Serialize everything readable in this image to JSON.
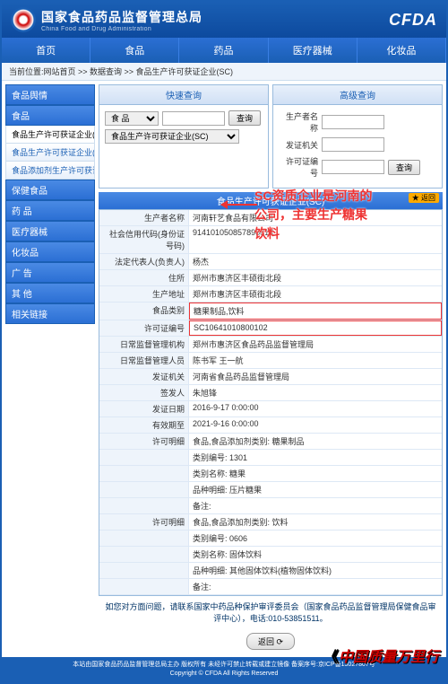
{
  "header": {
    "title_cn": "国家食品药品监督管理总局",
    "title_en": "China Food and Drug Administration",
    "brand": "CFDA"
  },
  "nav": [
    "首页",
    "食品",
    "药品",
    "医疗器械",
    "化妆品"
  ],
  "breadcrumb": "当前位置:网站首页 >> 数据查询 >> 食品生产许可获证企业(SC)",
  "sidebar": {
    "groups": [
      {
        "h": "食品舆情",
        "items": []
      },
      {
        "h": "食品",
        "items": [
          "食品生产许可获证企业(SC)",
          "食品生产许可获证企业(QS)",
          "食品添加剂生产许可获证企业"
        ]
      },
      {
        "h": "保健食品",
        "items": []
      },
      {
        "h": "药 品",
        "items": []
      },
      {
        "h": "医疗器械",
        "items": []
      },
      {
        "h": "化妆品",
        "items": []
      },
      {
        "h": "广 告",
        "items": []
      },
      {
        "h": "其 他",
        "items": []
      },
      {
        "h": "相关链接",
        "items": []
      }
    ]
  },
  "left_panel": {
    "title": "快速查询",
    "cat_label": "食 品",
    "btn": "查询",
    "sel": "食品生产许可获证企业(SC)"
  },
  "right_panel": {
    "title": "高级查询",
    "r1": "生产者名称",
    "r2": "发证机关",
    "r3": "许可证编号",
    "btn": "查询"
  },
  "section": {
    "title": "食品生产许可获证企业(SC)",
    "back": "★ 返回"
  },
  "detail": [
    {
      "l": "生产者名称",
      "v": "河南轩艺食品有限公司"
    },
    {
      "l": "社会信用代码(身份证号码)",
      "v": "91410105085789881K"
    },
    {
      "l": "法定代表人(负责人)",
      "v": "杨杰"
    },
    {
      "l": "住所",
      "v": "郑州市惠济区丰硕街北段"
    },
    {
      "l": "生产地址",
      "v": "郑州市惠济区丰硕街北段"
    },
    {
      "l": "食品类别",
      "v": "糖果制品,饮料",
      "hl": true
    },
    {
      "l": "许可证编号",
      "v": "SC10641010800102",
      "hl": true
    },
    {
      "l": "日常监督管理机构",
      "v": "郑州市惠济区食品药品监督管理局"
    },
    {
      "l": "日常监督管理人员",
      "v": "陈书军 王一航"
    },
    {
      "l": "发证机关",
      "v": "河南省食品药品监督管理局"
    },
    {
      "l": "签发人",
      "v": "朱旭锋"
    },
    {
      "l": "发证日期",
      "v": "2016-9-17 0:00:00"
    },
    {
      "l": "有效期至",
      "v": "2021-9-16 0:00:00"
    },
    {
      "l": "许可明细",
      "v": "食品,食品添加剂类别: 糖果制品"
    },
    {
      "l": "",
      "v": "类别编号: 1301"
    },
    {
      "l": "",
      "v": "类别名称: 糖果"
    },
    {
      "l": "",
      "v": "品种明细: 压片糖果"
    },
    {
      "l": "",
      "v": "备注:"
    },
    {
      "l": "许可明细",
      "v": "食品,食品添加剂类别: 饮料"
    },
    {
      "l": "",
      "v": "类别编号: 0606"
    },
    {
      "l": "",
      "v": "类别名称: 固体饮料"
    },
    {
      "l": "",
      "v": "品种明细: 其他固体饮料(植物固体饮料)"
    },
    {
      "l": "",
      "v": "备注:"
    }
  ],
  "annotation": {
    "l1": "SC资质企业是河南的",
    "l2": "公司，主要生产糖果",
    "l3": "饮料"
  },
  "note": "如您对方面问题，请联系国家中药品种保护审评委员会（国家食品药品监督管理局保健食品审评中心），电话:010-53851511。",
  "return_btn": "返回",
  "footer": {
    "l1": "本站由国家食品药品监督管理总局主办 版权所有 未经许可禁止转载或建立镜像 备案序号:京ICP备13027807号",
    "l2": "Copyright © CFDA All Rights Reserved"
  },
  "watermark": "中国质量万里行"
}
